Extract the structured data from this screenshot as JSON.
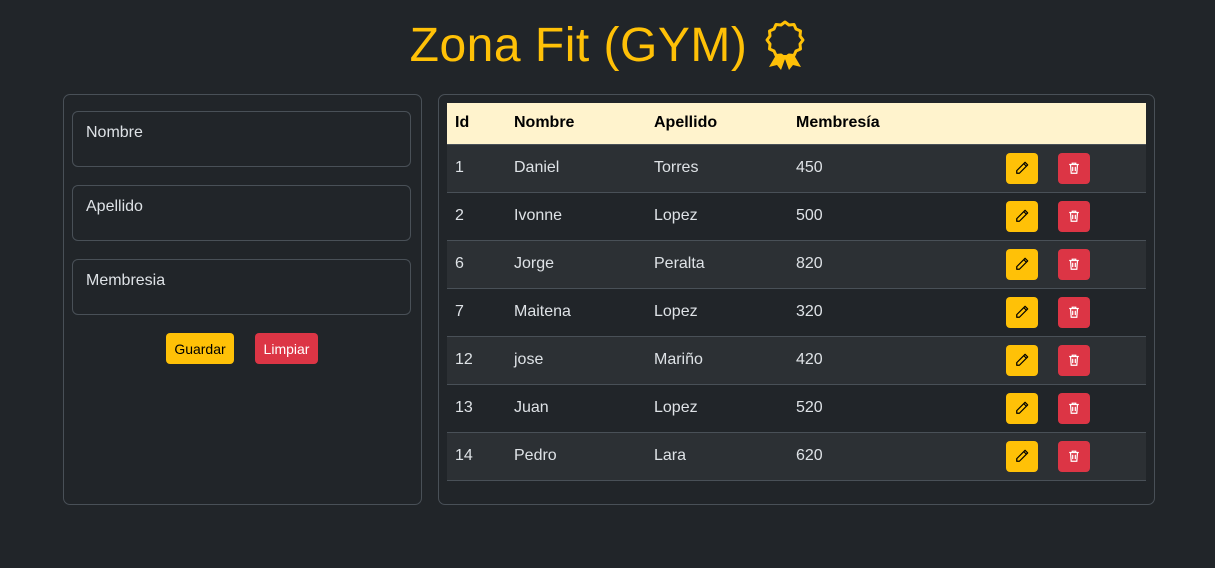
{
  "header": {
    "title": "Zona Fit (GYM)",
    "icon": "award-icon"
  },
  "form": {
    "fields": [
      {
        "label": "Nombre",
        "value": ""
      },
      {
        "label": "Apellido",
        "value": ""
      },
      {
        "label": "Membresia",
        "value": ""
      }
    ],
    "save_label": "Guardar",
    "clear_label": "Limpiar"
  },
  "table": {
    "headers": [
      "Id",
      "Nombre",
      "Apellido",
      "Membresía",
      ""
    ],
    "rows": [
      {
        "id": "1",
        "nombre": "Daniel",
        "apellido": "Torres",
        "membresia": "450"
      },
      {
        "id": "2",
        "nombre": "Ivonne",
        "apellido": "Lopez",
        "membresia": "500"
      },
      {
        "id": "6",
        "nombre": "Jorge",
        "apellido": "Peralta",
        "membresia": "820"
      },
      {
        "id": "7",
        "nombre": "Maitena",
        "apellido": "Lopez",
        "membresia": "320"
      },
      {
        "id": "12",
        "nombre": "jose",
        "apellido": "Mariño",
        "membresia": "420"
      },
      {
        "id": "13",
        "nombre": "Juan",
        "apellido": "Lopez",
        "membresia": "520"
      },
      {
        "id": "14",
        "nombre": "Pedro",
        "apellido": "Lara",
        "membresia": "620"
      }
    ]
  },
  "colors": {
    "background": "#212529",
    "accent": "#ffc107",
    "danger": "#dc3545",
    "table_header": "#fff3cd"
  }
}
